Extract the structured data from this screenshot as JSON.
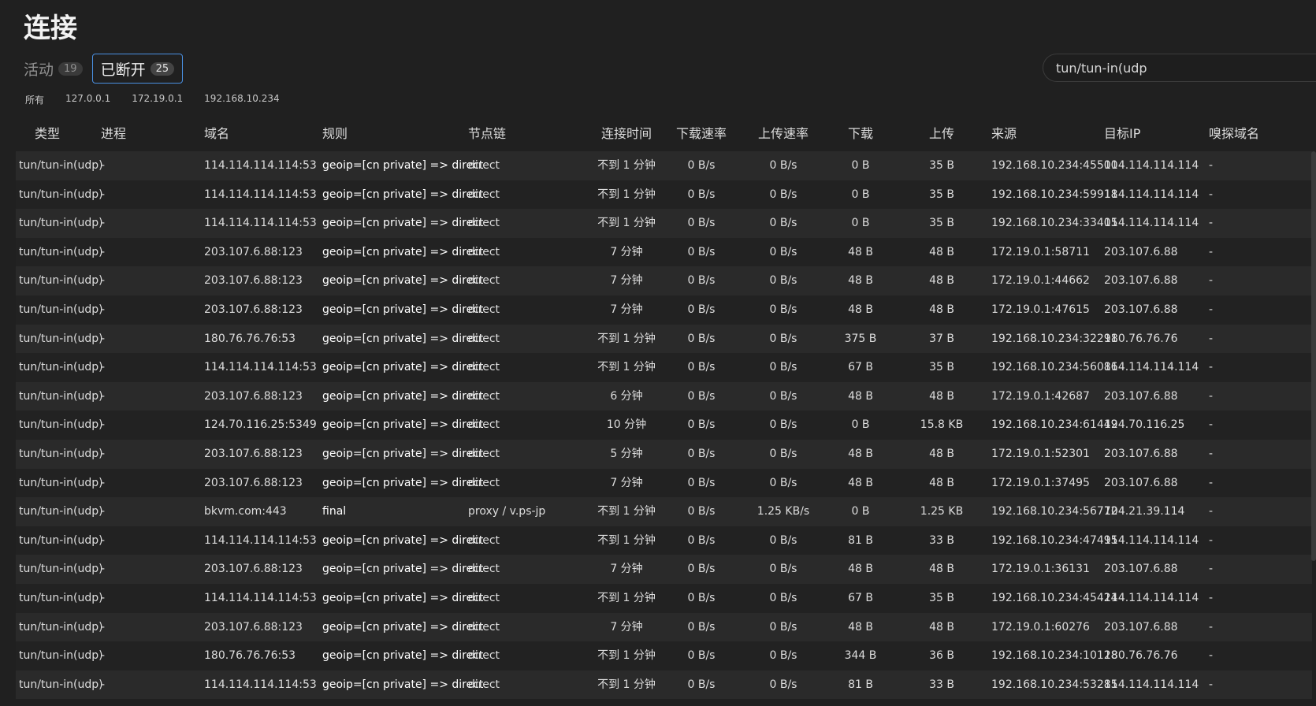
{
  "page": {
    "title": "连接"
  },
  "tabs": [
    {
      "label": "活动",
      "count": "19",
      "active": false
    },
    {
      "label": "已断开",
      "count": "25",
      "active": true
    }
  ],
  "search": {
    "value": "tun/tun-in(udp"
  },
  "filters": [
    "所有",
    "127.0.0.1",
    "172.19.0.1",
    "192.168.10.234"
  ],
  "table": {
    "columns": [
      "类型",
      "进程",
      "域名",
      "规则",
      "节点链",
      "连接时间",
      "下载速率",
      "上传速率",
      "下载",
      "上传",
      "来源",
      "目标IP",
      "嗅探域名"
    ],
    "rows": [
      [
        "tun/tun-in(udp)",
        "-",
        "114.114.114.114:53",
        "geoip=[cn private] => direct",
        "direct",
        "不到 1 分钟",
        "0 B/s",
        "0 B/s",
        "0 B",
        "35 B",
        "192.168.10.234:45500",
        "114.114.114.114",
        "-"
      ],
      [
        "tun/tun-in(udp)",
        "-",
        "114.114.114.114:53",
        "geoip=[cn private] => direct",
        "direct",
        "不到 1 分钟",
        "0 B/s",
        "0 B/s",
        "0 B",
        "35 B",
        "192.168.10.234:59918",
        "114.114.114.114",
        "-"
      ],
      [
        "tun/tun-in(udp)",
        "-",
        "114.114.114.114:53",
        "geoip=[cn private] => direct",
        "direct",
        "不到 1 分钟",
        "0 B/s",
        "0 B/s",
        "0 B",
        "35 B",
        "192.168.10.234:33405",
        "114.114.114.114",
        "-"
      ],
      [
        "tun/tun-in(udp)",
        "-",
        "203.107.6.88:123",
        "geoip=[cn private] => direct",
        "direct",
        "7 分钟",
        "0 B/s",
        "0 B/s",
        "48 B",
        "48 B",
        "172.19.0.1:58711",
        "203.107.6.88",
        "-"
      ],
      [
        "tun/tun-in(udp)",
        "-",
        "203.107.6.88:123",
        "geoip=[cn private] => direct",
        "direct",
        "7 分钟",
        "0 B/s",
        "0 B/s",
        "48 B",
        "48 B",
        "172.19.0.1:44662",
        "203.107.6.88",
        "-"
      ],
      [
        "tun/tun-in(udp)",
        "-",
        "203.107.6.88:123",
        "geoip=[cn private] => direct",
        "direct",
        "7 分钟",
        "0 B/s",
        "0 B/s",
        "48 B",
        "48 B",
        "172.19.0.1:47615",
        "203.107.6.88",
        "-"
      ],
      [
        "tun/tun-in(udp)",
        "-",
        "180.76.76.76:53",
        "geoip=[cn private] => direct",
        "direct",
        "不到 1 分钟",
        "0 B/s",
        "0 B/s",
        "375 B",
        "37 B",
        "192.168.10.234:32291",
        "180.76.76.76",
        "-"
      ],
      [
        "tun/tun-in(udp)",
        "-",
        "114.114.114.114:53",
        "geoip=[cn private] => direct",
        "direct",
        "不到 1 分钟",
        "0 B/s",
        "0 B/s",
        "67 B",
        "35 B",
        "192.168.10.234:56086",
        "114.114.114.114",
        "-"
      ],
      [
        "tun/tun-in(udp)",
        "-",
        "203.107.6.88:123",
        "geoip=[cn private] => direct",
        "direct",
        "6 分钟",
        "0 B/s",
        "0 B/s",
        "48 B",
        "48 B",
        "172.19.0.1:42687",
        "203.107.6.88",
        "-"
      ],
      [
        "tun/tun-in(udp)",
        "-",
        "124.70.116.25:5349",
        "geoip=[cn private] => direct",
        "direct",
        "10 分钟",
        "0 B/s",
        "0 B/s",
        "0 B",
        "15.8 KB",
        "192.168.10.234:61449",
        "124.70.116.25",
        "-"
      ],
      [
        "tun/tun-in(udp)",
        "-",
        "203.107.6.88:123",
        "geoip=[cn private] => direct",
        "direct",
        "5 分钟",
        "0 B/s",
        "0 B/s",
        "48 B",
        "48 B",
        "172.19.0.1:52301",
        "203.107.6.88",
        "-"
      ],
      [
        "tun/tun-in(udp)",
        "-",
        "203.107.6.88:123",
        "geoip=[cn private] => direct",
        "direct",
        "7 分钟",
        "0 B/s",
        "0 B/s",
        "48 B",
        "48 B",
        "172.19.0.1:37495",
        "203.107.6.88",
        "-"
      ],
      [
        "tun/tun-in(udp)",
        "-",
        "bkvm.com:443",
        "final",
        "proxy / v.ps-jp",
        "不到 1 分钟",
        "0 B/s",
        "1.25 KB/s",
        "0 B",
        "1.25 KB",
        "192.168.10.234:56772",
        "104.21.39.114",
        "-"
      ],
      [
        "tun/tun-in(udp)",
        "-",
        "114.114.114.114:53",
        "geoip=[cn private] => direct",
        "direct",
        "不到 1 分钟",
        "0 B/s",
        "0 B/s",
        "81 B",
        "33 B",
        "192.168.10.234:47495",
        "114.114.114.114",
        "-"
      ],
      [
        "tun/tun-in(udp)",
        "-",
        "203.107.6.88:123",
        "geoip=[cn private] => direct",
        "direct",
        "7 分钟",
        "0 B/s",
        "0 B/s",
        "48 B",
        "48 B",
        "172.19.0.1:36131",
        "203.107.6.88",
        "-"
      ],
      [
        "tun/tun-in(udp)",
        "-",
        "114.114.114.114:53",
        "geoip=[cn private] => direct",
        "direct",
        "不到 1 分钟",
        "0 B/s",
        "0 B/s",
        "67 B",
        "35 B",
        "192.168.10.234:45424",
        "114.114.114.114",
        "-"
      ],
      [
        "tun/tun-in(udp)",
        "-",
        "203.107.6.88:123",
        "geoip=[cn private] => direct",
        "direct",
        "7 分钟",
        "0 B/s",
        "0 B/s",
        "48 B",
        "48 B",
        "172.19.0.1:60276",
        "203.107.6.88",
        "-"
      ],
      [
        "tun/tun-in(udp)",
        "-",
        "180.76.76.76:53",
        "geoip=[cn private] => direct",
        "direct",
        "不到 1 分钟",
        "0 B/s",
        "0 B/s",
        "344 B",
        "36 B",
        "192.168.10.234:10128",
        "180.76.76.76",
        "-"
      ],
      [
        "tun/tun-in(udp)",
        "-",
        "114.114.114.114:53",
        "geoip=[cn private] => direct",
        "direct",
        "不到 1 分钟",
        "0 B/s",
        "0 B/s",
        "81 B",
        "33 B",
        "192.168.10.234:53285",
        "114.114.114.114",
        "-"
      ]
    ]
  }
}
